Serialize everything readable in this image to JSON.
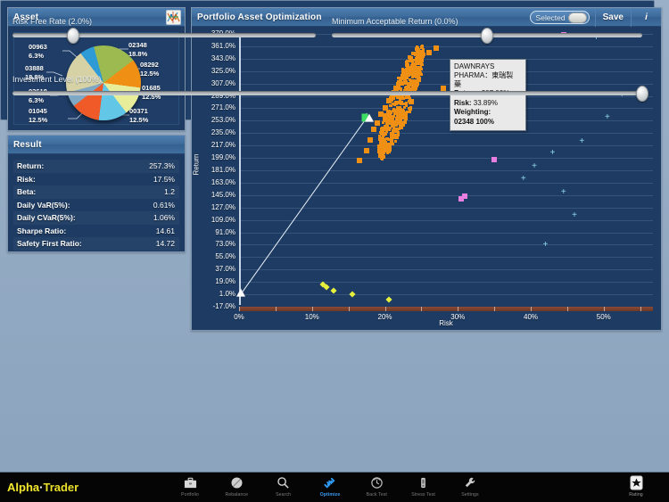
{
  "asset": {
    "title": "Asset",
    "header_icon": "network-chart-icon",
    "slices": [
      {
        "code": "02348",
        "pct": "18.8%",
        "value": 18.8,
        "color": "#9cba4f"
      },
      {
        "code": "08292",
        "pct": "12.5%",
        "value": 12.5,
        "color": "#ef8f14"
      },
      {
        "code": "01685",
        "pct": "12.5%",
        "value": 12.5,
        "color": "#e8ed9a"
      },
      {
        "code": "00371",
        "pct": "12.5%",
        "value": 12.5,
        "color": "#62c7e6"
      },
      {
        "code": "01045",
        "pct": "12.5%",
        "value": 12.5,
        "color": "#ef5a28"
      },
      {
        "code": "02618",
        "pct": "6.3%",
        "value": 6.3,
        "color": "#7fa8c4"
      },
      {
        "code": "03888",
        "pct": "18.8%",
        "value": 18.8,
        "color": "#d6d2a6"
      },
      {
        "code": "00963",
        "pct": "6.3%",
        "value": 6.3,
        "color": "#2e9ad6"
      }
    ]
  },
  "result": {
    "title": "Result",
    "rows": [
      {
        "key": "Return:",
        "value": "257.3%"
      },
      {
        "key": "Risk:",
        "value": "17.5%"
      },
      {
        "key": "Beta:",
        "value": "1.2"
      },
      {
        "key": "Daily VaR(5%):",
        "value": "0.61%"
      },
      {
        "key": "Daily CVaR(5%):",
        "value": "1.06%"
      },
      {
        "key": "Sharpe Ratio:",
        "value": "14.61"
      },
      {
        "key": "Safety First Ratio:",
        "value": "14.72"
      }
    ]
  },
  "chart_panel": {
    "title": "Portfolio Asset Optimization",
    "toggle_label": "Selected",
    "toggle_state": "off",
    "save_label": "Save",
    "info_label": "i"
  },
  "tooltip": {
    "name_line1": "DAWNRAYS",
    "name_line2": "PHARMA：東瑞製",
    "name_line3": "藥",
    "return_label": "Return:",
    "return_value": "207.00%",
    "risk_label": "Risk:",
    "risk_value": "33.89%",
    "weighting_label": "Weighting:",
    "weighting_value": "02348 100%"
  },
  "chart_data": {
    "type": "scatter",
    "title": "Portfolio Asset Optimization",
    "xlabel": "Risk",
    "ylabel": "Return",
    "xlim": [
      0,
      57
    ],
    "ylim": [
      -17,
      379
    ],
    "grid": true,
    "ytick_labels": [
      "379.0%",
      "361.0%",
      "343.0%",
      "325.0%",
      "307.0%",
      "289.0%",
      "271.0%",
      "253.0%",
      "235.0%",
      "217.0%",
      "199.0%",
      "181.0%",
      "163.0%",
      "145.0%",
      "127.0%",
      "109.0%",
      "91.0%",
      "73.0%",
      "55.0%",
      "37.0%",
      "19.0%",
      "1.0%",
      "-17.0%"
    ],
    "ytick_values": [
      379,
      361,
      343,
      325,
      307,
      289,
      271,
      253,
      235,
      217,
      199,
      181,
      163,
      145,
      127,
      109,
      91,
      73,
      55,
      37,
      19,
      1,
      -17
    ],
    "xtick_labels": [
      "0%",
      "10%",
      "20%",
      "30%",
      "40%",
      "50%"
    ],
    "xtick_values": [
      0,
      10,
      20,
      30,
      40,
      50
    ],
    "series": [
      {
        "name": "efficient-cloud",
        "marker": "square",
        "color": "#ef8f14",
        "points": [
          [
            16.5,
            195
          ],
          [
            17.5,
            210
          ],
          [
            18.0,
            225
          ],
          [
            18.5,
            240
          ],
          [
            19.0,
            250
          ],
          [
            19.5,
            262
          ],
          [
            20.0,
            272
          ],
          [
            20.5,
            282
          ],
          [
            21.0,
            292
          ],
          [
            21.5,
            300
          ],
          [
            22.0,
            308
          ],
          [
            22.5,
            315
          ],
          [
            23.0,
            322
          ],
          [
            23.5,
            328
          ],
          [
            24.0,
            334
          ],
          [
            24.5,
            340
          ],
          [
            25.0,
            345
          ],
          [
            26.0,
            352
          ],
          [
            27.0,
            358
          ],
          [
            28.0,
            300
          ]
        ]
      },
      {
        "name": "individual-assets-plus",
        "marker": "plus",
        "color": "#8fd8e8",
        "points": [
          [
            49.0,
            372
          ],
          [
            52.5,
            290
          ],
          [
            50.5,
            258
          ],
          [
            47.0,
            222
          ],
          [
            43.0,
            205
          ],
          [
            40.5,
            186
          ],
          [
            39.0,
            168
          ],
          [
            44.5,
            149
          ],
          [
            46.0,
            115
          ],
          [
            42.0,
            72
          ]
        ]
      },
      {
        "name": "individual-assets-square",
        "marker": "square",
        "color": "#e87fe0",
        "points": [
          [
            44.5,
            378
          ],
          [
            35.0,
            196
          ],
          [
            31.0,
            143
          ],
          [
            30.5,
            139
          ]
        ]
      },
      {
        "name": "low-risk-assets",
        "marker": "diamond",
        "color": "#e8f03c",
        "points": [
          [
            11.5,
            15
          ],
          [
            12.0,
            12
          ],
          [
            13.0,
            6
          ],
          [
            15.5,
            1
          ],
          [
            20.5,
            -7
          ]
        ]
      },
      {
        "name": "optimal-portfolio",
        "marker": "triangle",
        "color": "#ffffff",
        "points": [
          [
            17.5,
            257
          ]
        ]
      },
      {
        "name": "risk-free-point",
        "marker": "triangle",
        "color": "#ffffff",
        "points": [
          [
            0.3,
            2
          ]
        ]
      },
      {
        "name": "capital-allocation-line",
        "marker": "line",
        "color": "#e9f1f8",
        "points": [
          [
            0.3,
            2
          ],
          [
            17.5,
            257
          ]
        ]
      }
    ]
  },
  "sliders": [
    {
      "name": "risk-free-rate",
      "label": "Risk Free Rate (2.0%)",
      "value_pct": 20
    },
    {
      "name": "minimum-acceptable-return",
      "label": "Minimum Acceptable Return (0.0%)",
      "value_pct": 50
    },
    {
      "name": "investment-level",
      "label": "Investment Level (100%)",
      "value_pct": 100
    }
  ],
  "bottombar": {
    "brand_a": "Alpha",
    "brand_sep": "·",
    "brand_t": "Trader",
    "items": [
      {
        "label": "Portfolio",
        "icon": "briefcase-icon",
        "active": false
      },
      {
        "label": "Rebalance",
        "icon": "scale-icon",
        "active": false
      },
      {
        "label": "Search",
        "icon": "magnifier-icon",
        "active": false
      },
      {
        "label": "Optimize",
        "icon": "link-icon",
        "active": true
      },
      {
        "label": "Back Test",
        "icon": "clock-icon",
        "active": false
      },
      {
        "label": "Stress Test",
        "icon": "gauge-icon",
        "active": false
      },
      {
        "label": "Settings",
        "icon": "wrench-icon",
        "active": false
      }
    ],
    "rating": {
      "label": "Rating",
      "icon": "star-badge-icon"
    }
  }
}
